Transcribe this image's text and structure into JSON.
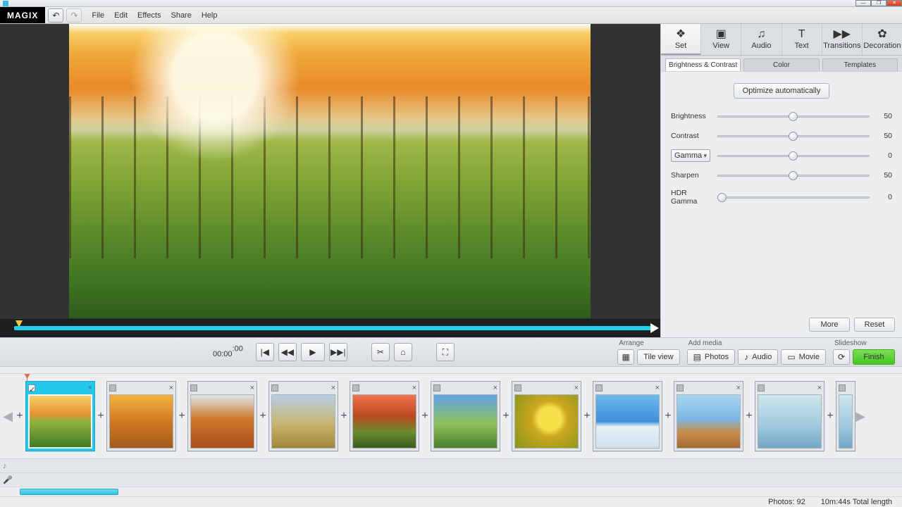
{
  "brand": "MAGIX",
  "menus": [
    "File",
    "Edit",
    "Effects",
    "Share",
    "Help"
  ],
  "winbtns": {
    "min": "—",
    "max": "❐",
    "close": "✕"
  },
  "tool_undo": "↶",
  "tool_redo": "↷",
  "rtools": [
    {
      "label": "Set",
      "icon": "❖"
    },
    {
      "label": "View",
      "icon": "▣"
    },
    {
      "label": "Audio",
      "icon": "♫"
    },
    {
      "label": "Text",
      "icon": "T"
    },
    {
      "label": "Transitions",
      "icon": "▶▶"
    },
    {
      "label": "Decoration",
      "icon": "✿"
    }
  ],
  "rtabs": [
    "Brightness & Contrast",
    "Color",
    "Templates"
  ],
  "optimize": "Optimize automatically",
  "sliders": {
    "brightness": {
      "label": "Brightness",
      "value": "50",
      "pos": 50
    },
    "contrast": {
      "label": "Contrast",
      "value": "50",
      "pos": 50
    },
    "gamma": {
      "label": "Gamma",
      "value": "0",
      "pos": 50
    },
    "sharpen": {
      "label": "Sharpen",
      "value": "50",
      "pos": 50
    },
    "hdr": {
      "label": "HDR Gamma",
      "value": "0",
      "pos": 3
    }
  },
  "more": "More",
  "reset": "Reset",
  "time_main": "00:00",
  "time_frac": "00",
  "transport": {
    "prev": "|◀",
    "rev": "◀◀",
    "play": "▶",
    "fwd": "▶▶|"
  },
  "tool_cut": "✂",
  "tool_home": "⌂",
  "tool_full": "⛶",
  "arrange": {
    "label": "Arrange",
    "grid": "▦",
    "tile": "Tile view"
  },
  "addmedia": {
    "label": "Add media",
    "photos": "Photos",
    "audio": "Audio",
    "movie": "Movie"
  },
  "slideshow": {
    "label": "Slideshow",
    "finish": "Finish",
    "playic": "⟳"
  },
  "icons": {
    "photos": "▤",
    "audio": "♪",
    "movie": "▭"
  },
  "clip_close": "×",
  "plus": "+",
  "status": {
    "photos": "Photos: 92",
    "length": "10m:44s Total length"
  },
  "arrow_l": "◀",
  "arrow_r": "▶"
}
